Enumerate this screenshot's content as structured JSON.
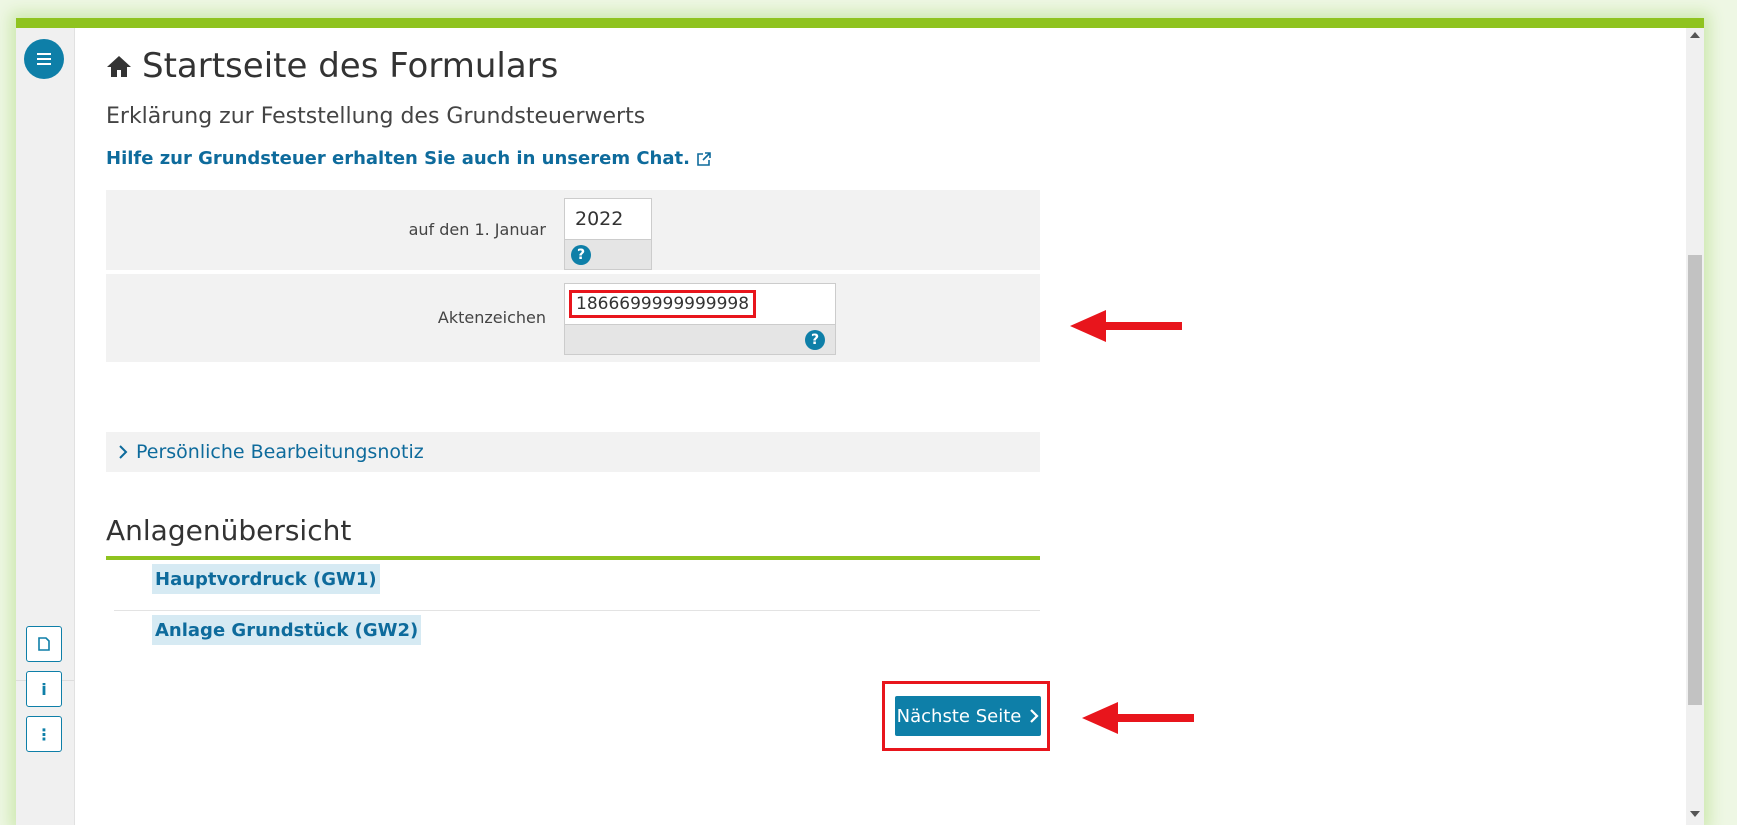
{
  "page": {
    "title": "Startseite des Formulars",
    "subtitle": "Erklärung zur Feststellung des Grundsteuerwerts",
    "chat_link": "Hilfe zur Grundsteuer erhalten Sie auch in unserem Chat."
  },
  "form": {
    "date_label": "auf den 1. Januar",
    "date_value": "2022",
    "aktenzeichen_label": "Aktenzeichen",
    "aktenzeichen_value": "1866699999999998",
    "help_symbol": "?"
  },
  "notiz": {
    "label": "Persönliche Bearbeitungsnotiz"
  },
  "anlagen": {
    "title": "Anlagenübersicht",
    "items": [
      {
        "label": "Hauptvordruck (GW1)"
      },
      {
        "label": "Anlage Grundstück (GW2)"
      }
    ]
  },
  "buttons": {
    "next_label": "Nächste Seite"
  },
  "sidebar": {
    "icons": [
      "menu-icon",
      "document-icon",
      "info-icon",
      "more-icon"
    ],
    "info_symbol": "i",
    "more_symbol": "⋮"
  },
  "colors": {
    "accent": "#0e7fa8",
    "green_bar": "#8fc31f",
    "annotation_red": "#e8151c"
  }
}
